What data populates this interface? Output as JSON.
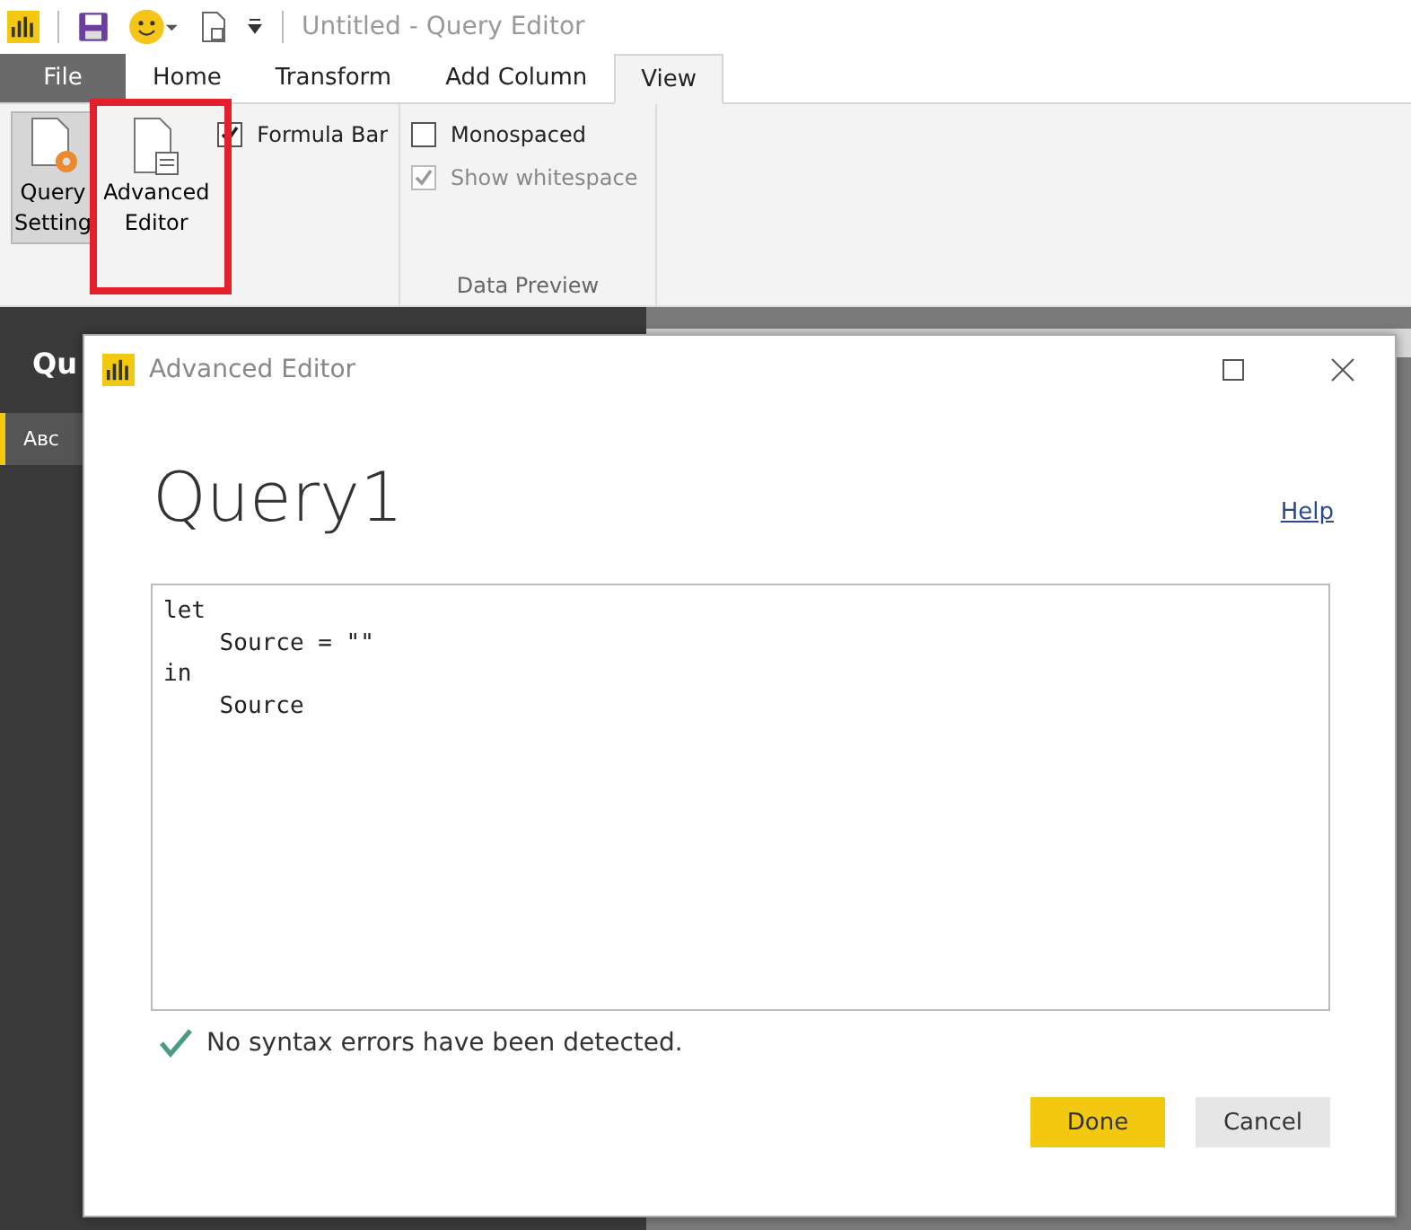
{
  "window": {
    "title": "Untitled - Query Editor"
  },
  "tabs": [
    {
      "label": "File",
      "kind": "file",
      "selected": false
    },
    {
      "label": "Home",
      "kind": "tab",
      "selected": false
    },
    {
      "label": "Transform",
      "kind": "tab",
      "selected": false
    },
    {
      "label": "Add Column",
      "kind": "tab",
      "selected": false
    },
    {
      "label": "View",
      "kind": "tab",
      "selected": true
    }
  ],
  "ribbon": {
    "large_buttons": [
      {
        "label": "Query\nSetting",
        "kind": "settings",
        "selected": true
      },
      {
        "label": "Advanced\nEditor",
        "kind": "editor",
        "selected": false
      }
    ],
    "show_group": {
      "options": [
        {
          "label": "Formula Bar",
          "checked": true,
          "disabled": false
        }
      ]
    },
    "preview_group": {
      "label": "Data Preview",
      "options": [
        {
          "label": "Monospaced",
          "checked": false,
          "disabled": false
        },
        {
          "label": "Show whitespace",
          "checked": true,
          "disabled": true
        }
      ]
    }
  },
  "side_panel": {
    "title": "Qu",
    "item": "Aʙᴄ"
  },
  "dialog": {
    "title": "Advanced Editor",
    "heading": "Query1",
    "help": "Help",
    "code": [
      "let",
      "    Source = \"\"",
      "in",
      "    Source"
    ],
    "status": "No syntax errors have been detected.",
    "buttons": [
      {
        "label": "Done",
        "kind": "primary"
      },
      {
        "label": "Cancel",
        "kind": "secondary"
      }
    ]
  }
}
